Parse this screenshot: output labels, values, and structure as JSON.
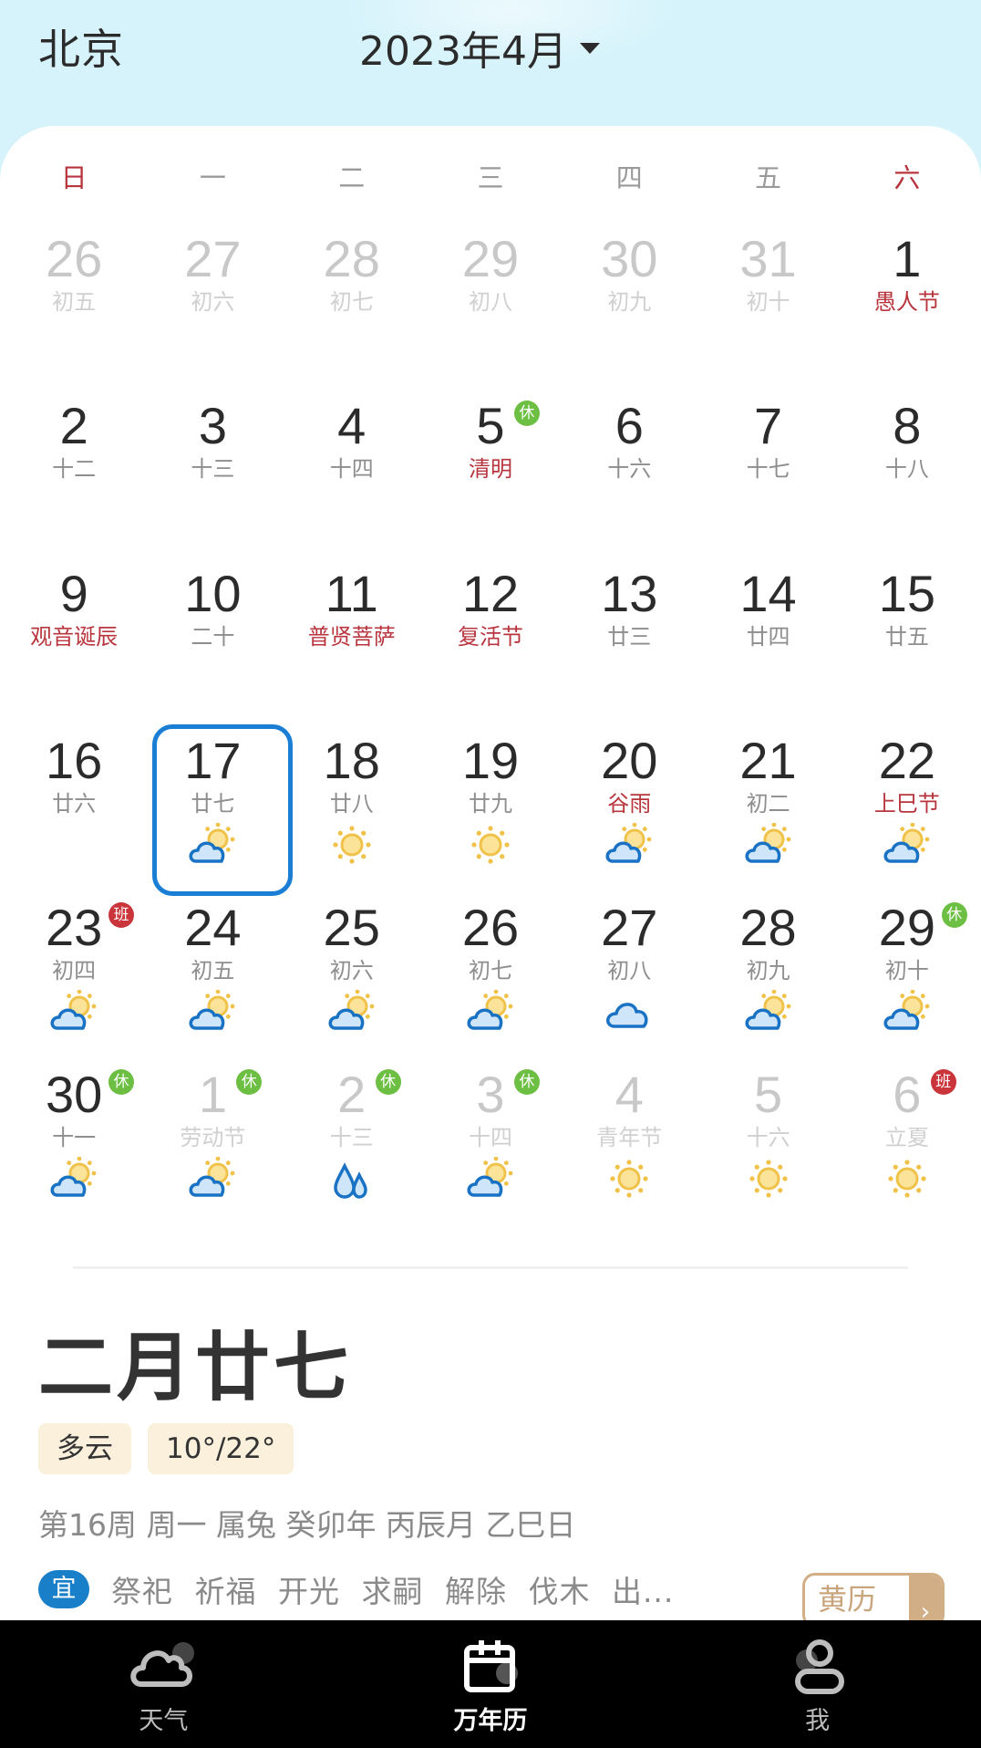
{
  "header": {
    "city": "北京",
    "month_label": "2023年4月",
    "month_dropdown_icon": "caret-down-icon"
  },
  "weekdays": [
    "日",
    "一",
    "二",
    "三",
    "四",
    "五",
    "六"
  ],
  "calendar": {
    "selected_date": "2023-04-17",
    "days": [
      {
        "day": "26",
        "lunar": "初五",
        "other_month": true
      },
      {
        "day": "27",
        "lunar": "初六",
        "other_month": true
      },
      {
        "day": "28",
        "lunar": "初七",
        "other_month": true
      },
      {
        "day": "29",
        "lunar": "初八",
        "other_month": true
      },
      {
        "day": "30",
        "lunar": "初九",
        "other_month": true
      },
      {
        "day": "31",
        "lunar": "初十",
        "other_month": true
      },
      {
        "day": "1",
        "lunar": "愚人节",
        "festival": true
      },
      {
        "day": "2",
        "lunar": "十二"
      },
      {
        "day": "3",
        "lunar": "十三"
      },
      {
        "day": "4",
        "lunar": "十四"
      },
      {
        "day": "5",
        "lunar": "清明",
        "festival": true,
        "badge": "休",
        "badge_type": "rest"
      },
      {
        "day": "6",
        "lunar": "十六"
      },
      {
        "day": "7",
        "lunar": "十七"
      },
      {
        "day": "8",
        "lunar": "十八"
      },
      {
        "day": "9",
        "lunar": "观音诞辰",
        "festival": true
      },
      {
        "day": "10",
        "lunar": "二十"
      },
      {
        "day": "11",
        "lunar": "普贤菩萨",
        "festival": true
      },
      {
        "day": "12",
        "lunar": "复活节",
        "festival": true
      },
      {
        "day": "13",
        "lunar": "廿三"
      },
      {
        "day": "14",
        "lunar": "廿四"
      },
      {
        "day": "15",
        "lunar": "廿五"
      },
      {
        "day": "16",
        "lunar": "廿六"
      },
      {
        "day": "17",
        "lunar": "廿七",
        "selected": true,
        "weather": "partly-cloudy"
      },
      {
        "day": "18",
        "lunar": "廿八",
        "weather": "sunny"
      },
      {
        "day": "19",
        "lunar": "廿九",
        "weather": "sunny"
      },
      {
        "day": "20",
        "lunar": "谷雨",
        "festival": true,
        "weather": "partly-cloudy"
      },
      {
        "day": "21",
        "lunar": "初二",
        "weather": "partly-cloudy"
      },
      {
        "day": "22",
        "lunar": "上巳节",
        "festival": true,
        "weather": "partly-cloudy"
      },
      {
        "day": "23",
        "lunar": "初四",
        "badge": "班",
        "badge_type": "work",
        "weather": "partly-cloudy"
      },
      {
        "day": "24",
        "lunar": "初五",
        "weather": "partly-cloudy"
      },
      {
        "day": "25",
        "lunar": "初六",
        "weather": "partly-cloudy"
      },
      {
        "day": "26",
        "lunar": "初七",
        "weather": "partly-cloudy"
      },
      {
        "day": "27",
        "lunar": "初八",
        "weather": "cloudy"
      },
      {
        "day": "28",
        "lunar": "初九",
        "weather": "partly-cloudy"
      },
      {
        "day": "29",
        "lunar": "初十",
        "badge": "休",
        "badge_type": "rest",
        "weather": "partly-cloudy"
      },
      {
        "day": "30",
        "lunar": "十一",
        "badge": "休",
        "badge_type": "rest",
        "weather": "partly-cloudy"
      },
      {
        "day": "1",
        "lunar": "劳动节",
        "other_month": true,
        "badge": "休",
        "badge_type": "rest",
        "weather": "partly-cloudy"
      },
      {
        "day": "2",
        "lunar": "十三",
        "other_month": true,
        "badge": "休",
        "badge_type": "rest",
        "weather": "rain"
      },
      {
        "day": "3",
        "lunar": "十四",
        "other_month": true,
        "badge": "休",
        "badge_type": "rest",
        "weather": "partly-cloudy"
      },
      {
        "day": "4",
        "lunar": "青年节",
        "other_month": true,
        "weather": "sunny"
      },
      {
        "day": "5",
        "lunar": "十六",
        "other_month": true,
        "weather": "sunny"
      },
      {
        "day": "6",
        "lunar": "立夏",
        "other_month": true,
        "badge": "班",
        "badge_type": "work",
        "weather": "sunny"
      }
    ]
  },
  "detail": {
    "lunar_date": "二月廿七",
    "weather": "多云",
    "temperature": "10°/22°",
    "ganzhi": "第16周 周一 属兔 癸卯年 丙辰月 乙巳日",
    "yi_label": "宜",
    "yi_items": "祭祀  祈福  开光  求嗣  解除  伐木  出...",
    "huangli_button": "黄历",
    "huangli_arrow": "›"
  },
  "tabbar": {
    "tabs": [
      {
        "label": "天气",
        "icon": "cloud-icon",
        "active": false
      },
      {
        "label": "万年历",
        "icon": "calendar-icon",
        "active": true
      },
      {
        "label": "我",
        "icon": "user-icon",
        "active": false
      }
    ]
  },
  "colors": {
    "accent_blue": "#1a7fd4",
    "festival_red": "#b8353e",
    "rest_green": "#6cbf43",
    "work_red": "#c9353a",
    "huangli_tan": "#d1ae86"
  }
}
